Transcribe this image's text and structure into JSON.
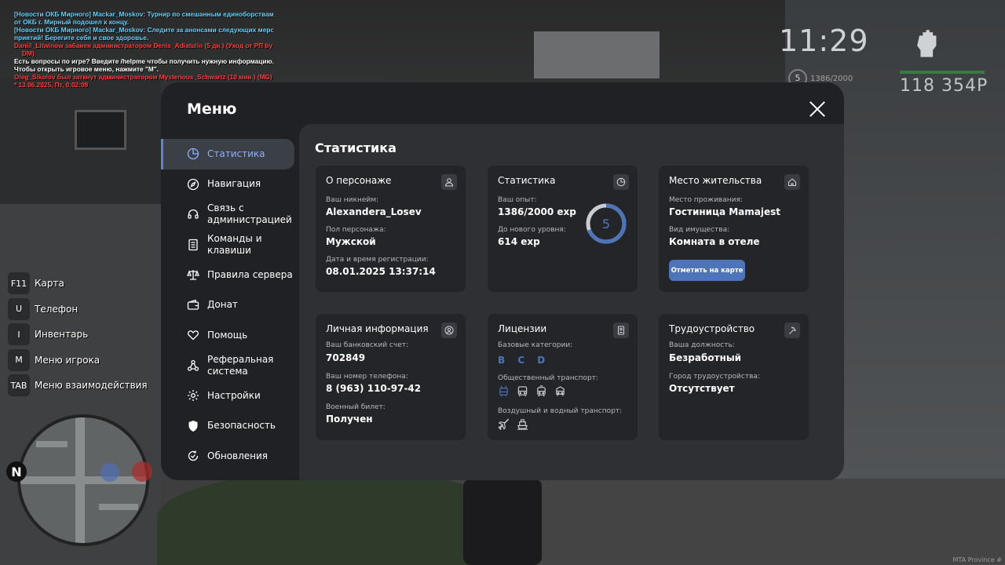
{
  "chat": [
    {
      "text": "[Новости ОКБ Мирного] Mackar_Moskov: Турнир по смешанным единоборствам",
      "color": "cyan"
    },
    {
      "text": "от ОКБ г. Мирный подошел к концу.",
      "color": "cyan"
    },
    {
      "text": "[Новости ОКБ Мирного] Mackar_Moskov: Следите за анонсами следующих меро",
      "color": "cyan"
    },
    {
      "text": "приятий! Берегите себя и свое здоровье.",
      "color": "cyan"
    },
    {
      "text": "Daniil_Litwinow забанен администратором Denis_Adiatulin (5 дн.) (Уход от РП by",
      "color": "red"
    },
    {
      "text": "DM)",
      "color": "red"
    },
    {
      "text": "Есть вопросы по игре? Введите /helpme чтобы получить нужную информацию.",
      "color": "white"
    },
    {
      "text": "Чтобы открыть игровое меню, нажмите \"M\".",
      "color": "white"
    },
    {
      "text": "Oleg_Sikolov был заткнут администратором Mysterious_Schwartz (10 мин.) (MG)",
      "color": "red"
    },
    {
      "text": "* 13.06.2025, Пт, 0:02:09",
      "color": "red"
    }
  ],
  "hud": {
    "time": "11:29",
    "level": "5",
    "exp": "1386/2000",
    "money": "118 354Р"
  },
  "hotkeys": [
    {
      "key": "F11",
      "label": "Карта"
    },
    {
      "key": "U",
      "label": "Телефон"
    },
    {
      "key": "I",
      "label": "Инвентарь"
    },
    {
      "key": "M",
      "label": "Меню игрока"
    },
    {
      "key": "TAB",
      "label": "Меню взаимодействия"
    }
  ],
  "minimap": {
    "north": "N"
  },
  "watermark": "MTA Province #",
  "menu": {
    "title": "Меню",
    "sidebar": [
      {
        "label": "Статистика",
        "icon": "pie-chart-icon",
        "active": true
      },
      {
        "label": "Навигация",
        "icon": "compass-icon"
      },
      {
        "label": "Связь с администрацией",
        "icon": "headset-icon"
      },
      {
        "label": "Команды и клавиши",
        "icon": "document-icon"
      },
      {
        "label": "Правила сервера",
        "icon": "scales-icon"
      },
      {
        "label": "Донат",
        "icon": "wallet-icon"
      },
      {
        "label": "Помощь",
        "icon": "heart-hand-icon"
      },
      {
        "label": "Реферальная система",
        "icon": "network-icon"
      },
      {
        "label": "Настройки",
        "icon": "gear-icon"
      },
      {
        "label": "Безопасность",
        "icon": "shield-icon"
      },
      {
        "label": "Обновления",
        "icon": "refresh-check-icon"
      }
    ],
    "content_title": "Статистика",
    "character": {
      "title": "О персонаже",
      "nickname_label": "Ваш никнейм:",
      "nickname": "Alexandera_Losev",
      "gender_label": "Пол персонажа:",
      "gender": "Мужской",
      "reg_label": "Дата и время регистрации:",
      "reg": "08.01.2025 13:37:14"
    },
    "stats": {
      "title": "Статистика",
      "exp_label": "Ваш опыт:",
      "exp": "1386/2000 exp",
      "next_label": "До нового уровня:",
      "next": "614 exp",
      "level": "5",
      "progress": 0.693
    },
    "residence": {
      "title": "Место жительства",
      "place_label": "Место проживания:",
      "place": "Гостиница Mamajest",
      "type_label": "Вид имущества:",
      "type": "Комната в отеле",
      "button": "Отметить на карте"
    },
    "personal": {
      "title": "Личная информация",
      "bank_label": "Ваш банковский счет:",
      "bank": "702849",
      "phone_label": "Ваш номер телефона:",
      "phone": "8 (963) 110-97-42",
      "military_label": "Военный билет:",
      "military": "Получен"
    },
    "licenses": {
      "title": "Лицензии",
      "base_label": "Базовые категории:",
      "base": "B C D",
      "public_label": "Общественный транспорт:",
      "air_label": "Воздушный и водный транспорт:"
    },
    "employment": {
      "title": "Трудоустройство",
      "position_label": "Ваша должность:",
      "position": "Безработный",
      "city_label": "Город трудоустройства:",
      "city": "Отсутствует"
    }
  },
  "colors": {
    "accent": "#4d74b8",
    "active_text": "#8fb0ff"
  }
}
